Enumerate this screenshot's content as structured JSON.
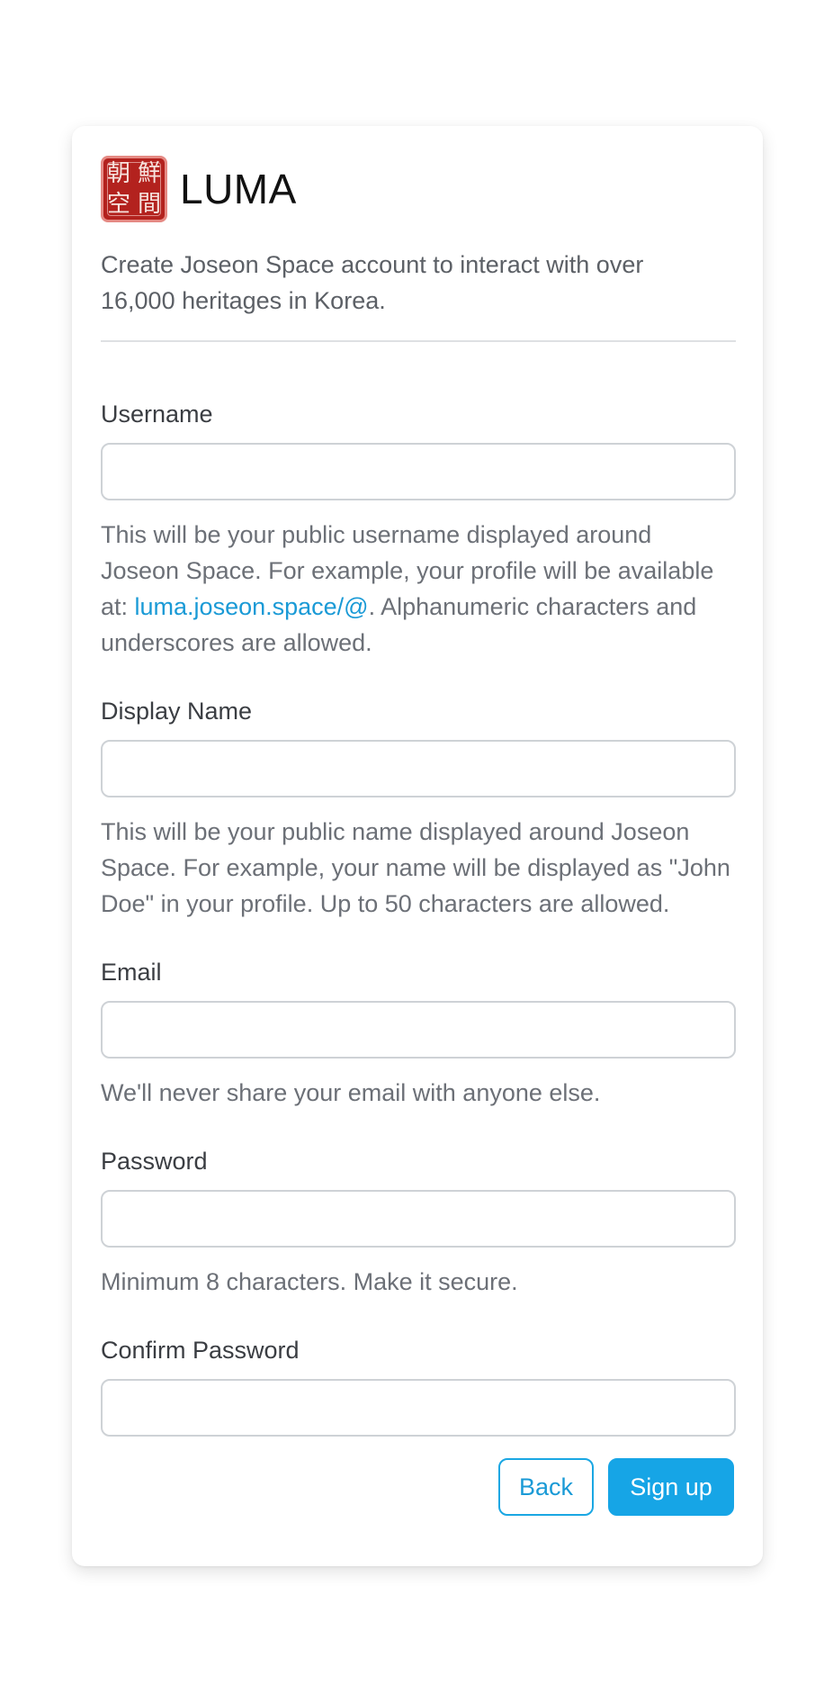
{
  "brand": {
    "name": "LUMA",
    "logo_glyphs": [
      "朝",
      "鮮",
      "空",
      "間"
    ],
    "tagline": "Create Joseon Space account to interact with over 16,000 heritages in Korea."
  },
  "form": {
    "username": {
      "label": "Username",
      "value": "",
      "help_before": "This will be your public username displayed around Joseon Space. For example, your profile will be available at: ",
      "help_link": "luma.joseon.space/@",
      "help_after": ". Alphanumeric characters and underscores are allowed."
    },
    "display_name": {
      "label": "Display Name",
      "value": "",
      "help": "This will be your public name displayed around Joseon Space. For example, your name will be displayed as \"John Doe\" in your profile. Up to 50 characters are allowed."
    },
    "email": {
      "label": "Email",
      "value": "",
      "help": "We'll never share your email with anyone else."
    },
    "password": {
      "label": "Password",
      "value": "",
      "help": "Minimum 8 characters. Make it secure."
    },
    "confirm_password": {
      "label": "Confirm Password",
      "value": ""
    }
  },
  "actions": {
    "back_label": "Back",
    "signup_label": "Sign up"
  },
  "colors": {
    "accent": "#16a5e6",
    "link": "#1a9ad6",
    "logo_red": "#b3221e"
  }
}
